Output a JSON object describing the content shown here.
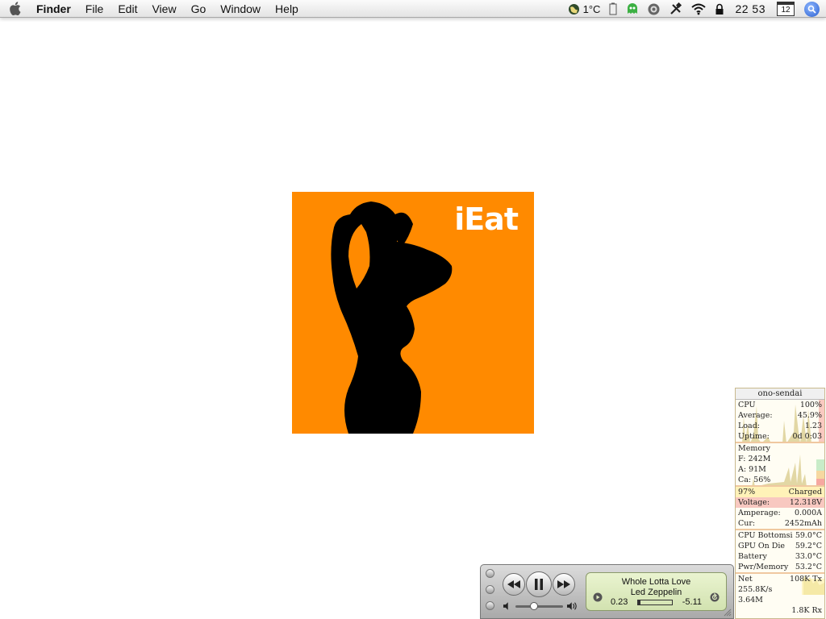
{
  "menubar": {
    "app_name": "Finder",
    "menus": [
      "File",
      "Edit",
      "View",
      "Go",
      "Window",
      "Help"
    ],
    "temperature": "1°C",
    "clock": "22 53",
    "calendar_day": "12"
  },
  "image": {
    "brand_text": "iEat",
    "background_color": "#ff8a00"
  },
  "stats": {
    "host": "ono-sendai",
    "cpu": {
      "label": "CPU",
      "value": "100%",
      "average_label": "Average:",
      "average": "45.9%",
      "load_label": "Load:",
      "load": "1.23",
      "uptime_label": "Uptime:",
      "uptime": "0d 0:03"
    },
    "memory": {
      "label": "Memory",
      "free": "F: 242M",
      "active": "A: 91M",
      "cache": "Ca: 56%"
    },
    "battery": {
      "percent": "97%",
      "status": "Charged",
      "voltage_label": "Voltage:",
      "voltage": "12.318V",
      "amperage_label": "Amperage:",
      "amperage": "0.000A",
      "current_label": "Cur:",
      "current": "2452mAh"
    },
    "temps": [
      {
        "label": "CPU Bottomsi",
        "value": "59.0°C"
      },
      {
        "label": "GPU On Die",
        "value": "59.2°C"
      },
      {
        "label": "Battery",
        "value": "33.0°C"
      },
      {
        "label": "Pwr/Memory B",
        "value": "53.2°C"
      }
    ],
    "net": {
      "label": "Net",
      "tx": "108K Tx",
      "rate": "255.8K/s",
      "total": "3.64M",
      "rx": "1.8K Rx"
    }
  },
  "player": {
    "song": "Whole Lotta Love",
    "artist": "Led Zeppelin",
    "elapsed": "0.23",
    "remaining": "-5.11",
    "progress": 0.07,
    "volume": 0.4
  }
}
